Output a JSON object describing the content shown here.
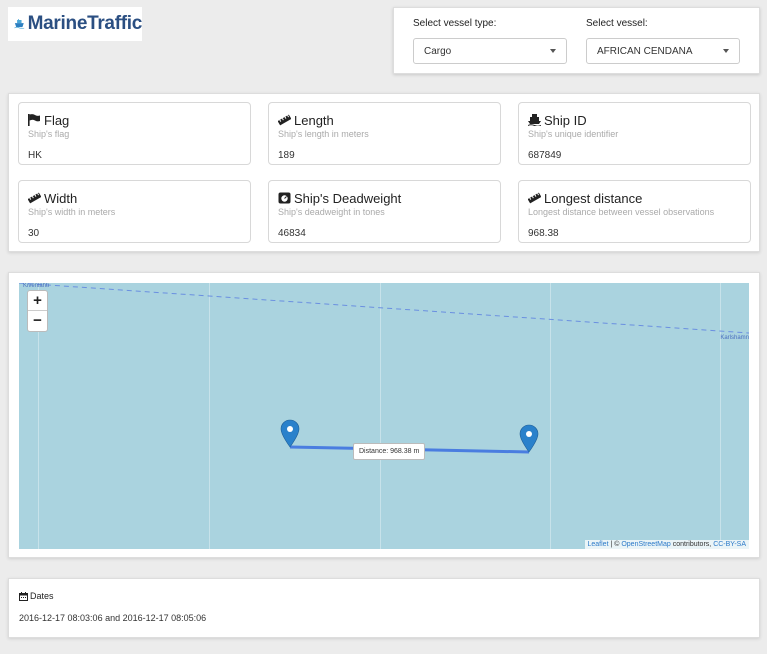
{
  "brand": {
    "name": "MarineTraffic"
  },
  "selectors": {
    "vessel_type_label": "Select vessel type:",
    "vessel_type_value": "Cargo",
    "vessel_label": "Select vessel:",
    "vessel_value": "AFRICAN CENDANA"
  },
  "info_cards": [
    {
      "icon": "flag-icon",
      "title": "Flag",
      "desc": "Ship's flag",
      "value": "HK"
    },
    {
      "icon": "ruler-icon",
      "title": "Length",
      "desc": "Ship's length in meters",
      "value": "189"
    },
    {
      "icon": "ship-icon",
      "title": "Ship ID",
      "desc": "Ship's unique identifier",
      "value": "687849"
    },
    {
      "icon": "ruler-icon",
      "title": "Width",
      "desc": "Ship's width in meters",
      "value": "30"
    },
    {
      "icon": "weight-icon",
      "title": "Ship's Deadweight",
      "desc": "Ship's deadweight in tones",
      "value": "46834"
    },
    {
      "icon": "ruler-icon",
      "title": "Longest distance",
      "desc": "Longest distance between vessel observations",
      "value": "968.38"
    }
  ],
  "map": {
    "zoom_in": "+",
    "zoom_out": "−",
    "distance_tooltip": "Distance: 968.38 m",
    "place_left": "Kivenlahti",
    "place_right": "Karlshamn",
    "attribution_leaflet": "Leaflet",
    "attribution_sep": " | © ",
    "attribution_osm": "OpenStreetMap",
    "attribution_mid": " contributors, ",
    "attribution_license": "CC-BY-SA"
  },
  "dates": {
    "title": "Dates",
    "value": "2016-12-17 08:03:06 and 2016-12-17 08:05:06"
  },
  "colors": {
    "map_water": "#aad3df",
    "route": "#4a7de0",
    "marker": "#2a81cb",
    "brand": "#2b4f82"
  }
}
